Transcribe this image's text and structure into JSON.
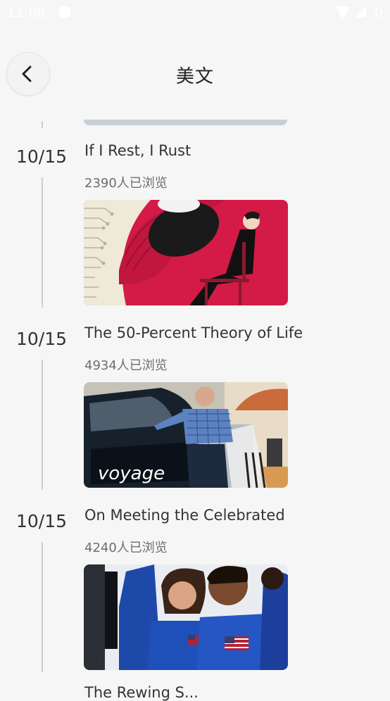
{
  "status_bar": {
    "time": "11:08",
    "battery": "0"
  },
  "header": {
    "title": "美文"
  },
  "entries": [
    {
      "date": "10/15",
      "title": "If I Rest, I Rust",
      "views": "2390人已浏览",
      "image": "illustration-man-on-chair"
    },
    {
      "date": "10/15",
      "title": "The 50-Percent Theory of Life",
      "views": "4934人已浏览",
      "image": "photo-man-exiting-car",
      "image_watermark": "voyage"
    },
    {
      "date": "10/15",
      "title": "On Meeting the Celebrated",
      "views": "4240人已浏览",
      "image": "photo-students-in-flight-suits"
    }
  ],
  "next_entry": {
    "title": "The Rewing S..."
  },
  "colors": {
    "background": "#f6f6f6",
    "accent_red": "#d41a47",
    "timeline": "#cfcfcf"
  }
}
